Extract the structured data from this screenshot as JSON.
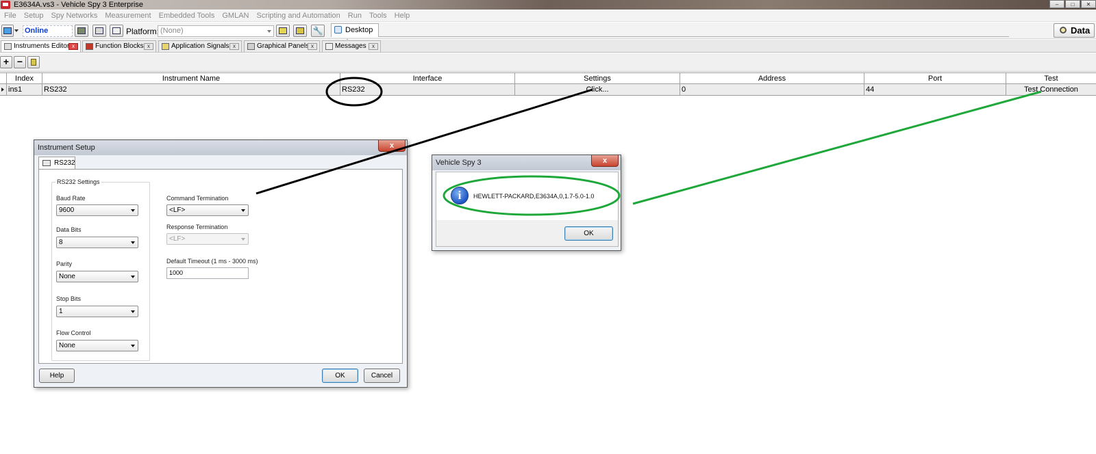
{
  "window": {
    "title": "E3634A.vs3 - Vehicle Spy 3 Enterprise",
    "controls": [
      "–",
      "□",
      "✕"
    ]
  },
  "menu": [
    "File",
    "Setup",
    "Spy Networks",
    "Measurement",
    "Embedded Tools",
    "GMLAN",
    "Scripting and Automation",
    "Run",
    "Tools",
    "Help"
  ],
  "toolbar": {
    "status": "Online",
    "platform_label": "Platform:",
    "platform_value": "(None)",
    "desktop_tab": "Desktop 1",
    "data_button": "Data"
  },
  "tabs": [
    {
      "label": "Instruments Editor",
      "icon": "instruments-icon",
      "active": true
    },
    {
      "label": "Function Blocks",
      "icon": "function-blocks-icon",
      "active": false
    },
    {
      "label": "Application Signals",
      "icon": "signals-icon",
      "active": false
    },
    {
      "label": "Graphical Panels",
      "icon": "panels-icon",
      "active": false
    },
    {
      "label": "Messages",
      "icon": "messages-icon",
      "active": false
    }
  ],
  "small_toolbar": {
    "add": "+",
    "remove": "−"
  },
  "grid": {
    "headers": [
      "Index",
      "Instrument Name",
      "Interface",
      "Settings",
      "Address",
      "Port",
      "Test"
    ],
    "rows": [
      {
        "index": "ins1",
        "name": "RS232",
        "interface": "RS232",
        "settings": "Click...",
        "address": "0",
        "port": "44",
        "test": "Test Connection"
      }
    ]
  },
  "instrument_setup": {
    "title": "Instrument Setup",
    "close": "x",
    "tab": "RS232",
    "group_label": "RS232 Settings",
    "baud_rate": {
      "label": "Baud Rate",
      "value": "9600"
    },
    "data_bits": {
      "label": "Data Bits",
      "value": "8"
    },
    "parity": {
      "label": "Parity",
      "value": "None"
    },
    "stop_bits": {
      "label": "Stop Bits",
      "value": "1"
    },
    "flow_control": {
      "label": "Flow Control",
      "value": "None"
    },
    "command_termination": {
      "label": "Command Termination",
      "value": "<LF>"
    },
    "response_termination": {
      "label": "Response Termination",
      "value": "<LF>"
    },
    "default_timeout": {
      "label": "Default Timeout (1 ms - 3000 ms)",
      "value": "1000"
    },
    "help_button": "Help",
    "ok_button": "OK",
    "cancel_button": "Cancel"
  },
  "message_box": {
    "title": "Vehicle Spy 3",
    "close": "x",
    "message": "HEWLETT-PACKARD,E3634A,0,1.7-5.0-1.0",
    "ok_button": "OK"
  },
  "colors": {
    "online_text": "#0b3fcf",
    "annotation_black": "#000000",
    "annotation_green": "#1fa83a",
    "info_icon": "#1f57c3"
  }
}
